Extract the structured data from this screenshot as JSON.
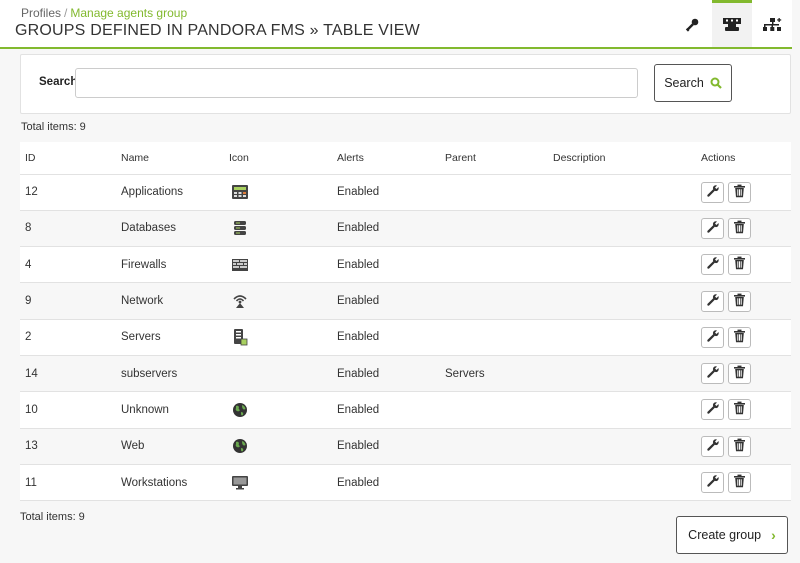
{
  "breadcrumb": {
    "parent": "Profiles",
    "separator": "/",
    "current": "Manage agents group"
  },
  "page_title": "GROUPS DEFINED IN PANDORA FMS » TABLE VIEW",
  "header_tabs": [
    {
      "icon": "key-icon",
      "active": false
    },
    {
      "icon": "table-view-icon",
      "active": true
    },
    {
      "icon": "tree-view-icon",
      "active": false
    }
  ],
  "search": {
    "label": "Search",
    "value": "",
    "placeholder": "",
    "button_label": "Search"
  },
  "total_items_label": "Total items: 9",
  "table": {
    "headers": {
      "id": "ID",
      "name": "Name",
      "icon": "Icon",
      "alerts": "Alerts",
      "parent": "Parent",
      "description": "Description",
      "actions": "Actions"
    },
    "rows": [
      {
        "id": "12",
        "name": "Applications",
        "icon": "applications-icon",
        "alerts": "Enabled",
        "parent": "",
        "description": ""
      },
      {
        "id": "8",
        "name": "Databases",
        "icon": "database-icon",
        "alerts": "Enabled",
        "parent": "",
        "description": ""
      },
      {
        "id": "4",
        "name": "Firewalls",
        "icon": "firewall-icon",
        "alerts": "Enabled",
        "parent": "",
        "description": ""
      },
      {
        "id": "9",
        "name": "Network",
        "icon": "network-icon",
        "alerts": "Enabled",
        "parent": "",
        "description": ""
      },
      {
        "id": "2",
        "name": "Servers",
        "icon": "server-icon",
        "alerts": "Enabled",
        "parent": "",
        "description": ""
      },
      {
        "id": "14",
        "name": "subservers",
        "icon": "",
        "alerts": "Enabled",
        "parent": "Servers",
        "description": ""
      },
      {
        "id": "10",
        "name": "Unknown",
        "icon": "globe-icon",
        "alerts": "Enabled",
        "parent": "",
        "description": ""
      },
      {
        "id": "13",
        "name": "Web",
        "icon": "globe-icon",
        "alerts": "Enabled",
        "parent": "",
        "description": ""
      },
      {
        "id": "11",
        "name": "Workstations",
        "icon": "workstation-icon",
        "alerts": "Enabled",
        "parent": "",
        "description": ""
      }
    ]
  },
  "create_button_label": "Create group",
  "colors": {
    "accent": "#82b92e",
    "row_alt": "#f7f7f7"
  }
}
